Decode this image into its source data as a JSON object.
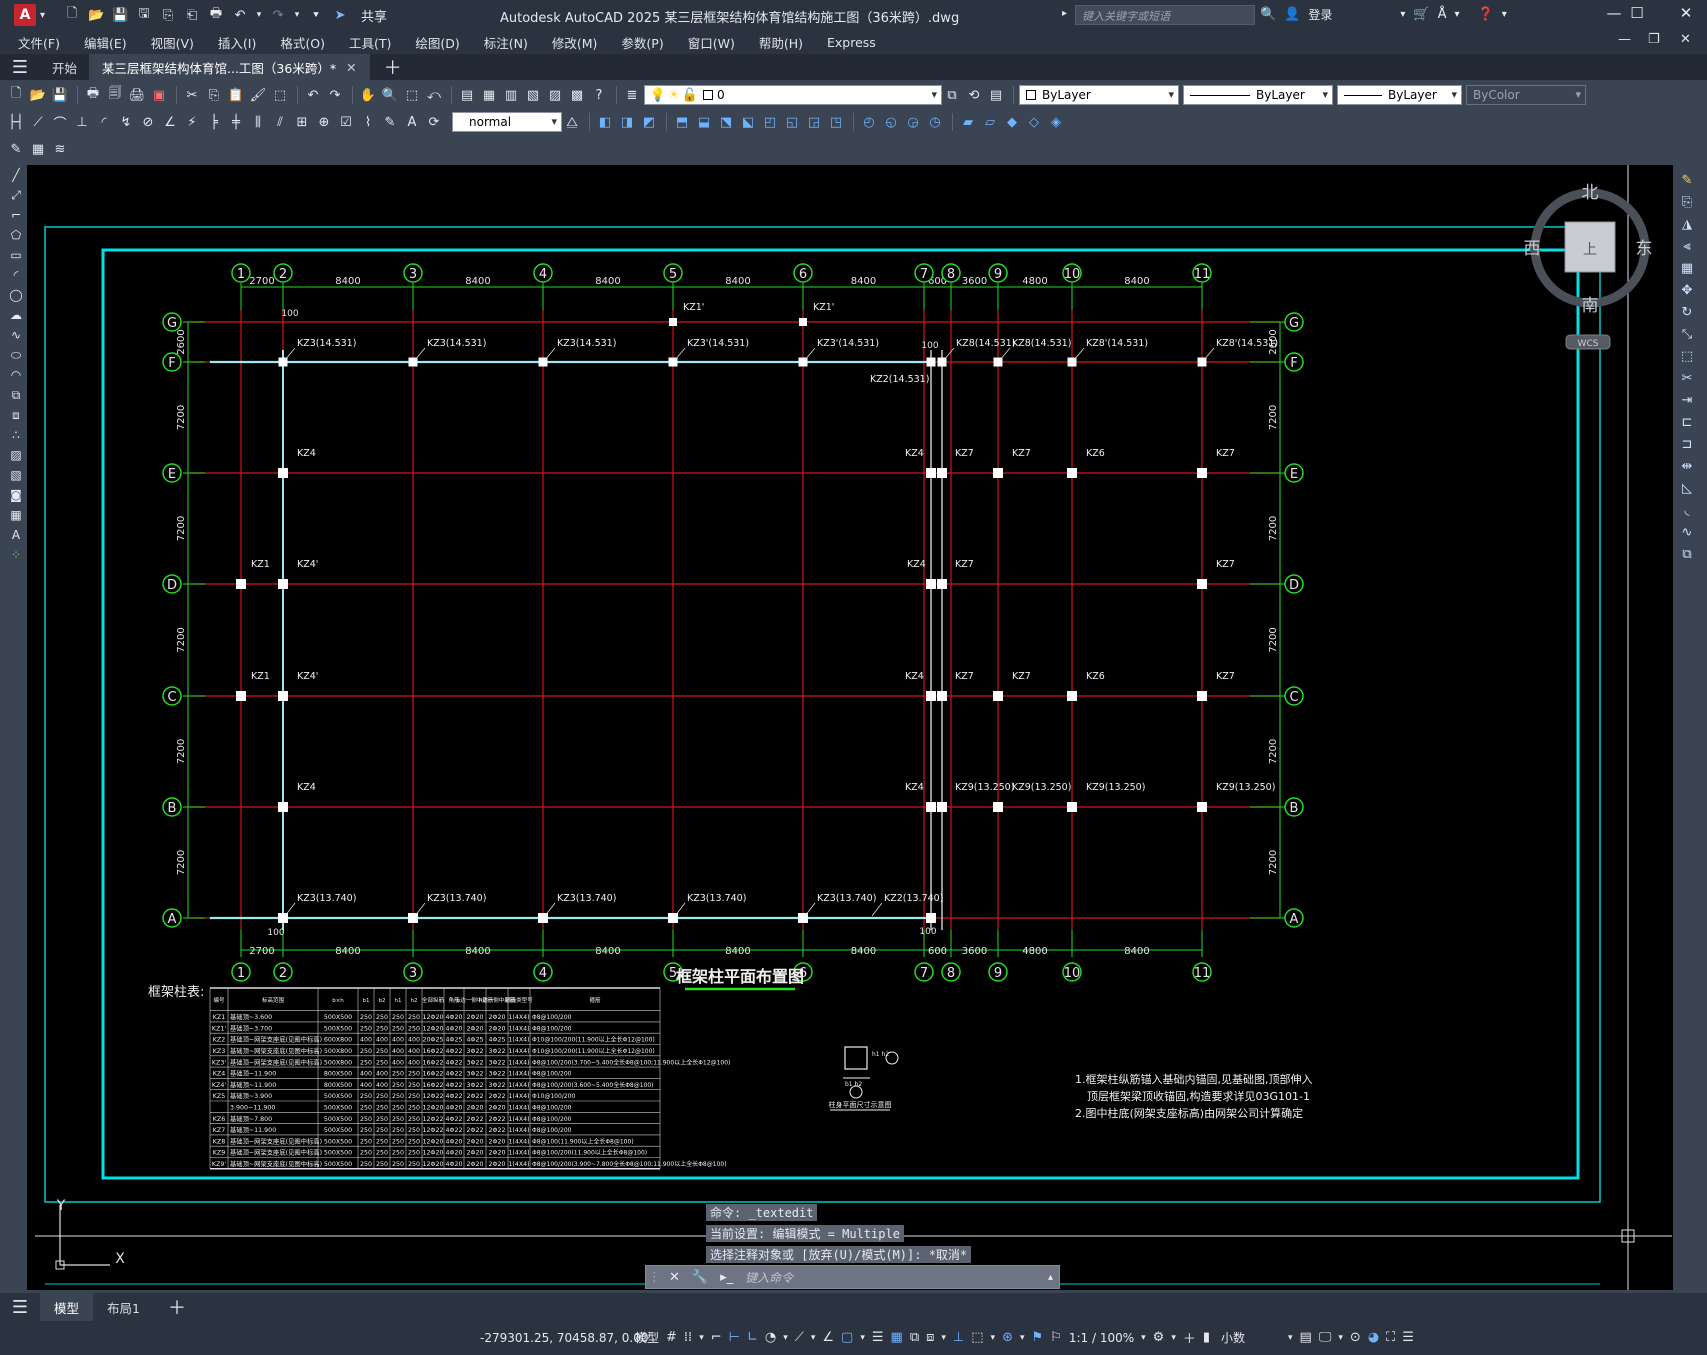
{
  "app": {
    "title": "Autodesk AutoCAD 2025    某三层框架结构体育馆结构施工图（36米跨）.dwg",
    "logo_letter": "A",
    "share_label": "共享",
    "search_placeholder": "键入关键字或短语",
    "login_label": "登录"
  },
  "menu": [
    "文件(F)",
    "编辑(E)",
    "视图(V)",
    "插入(I)",
    "格式(O)",
    "工具(T)",
    "绘图(D)",
    "标注(N)",
    "修改(M)",
    "参数(P)",
    "窗口(W)",
    "帮助(H)",
    "Express"
  ],
  "tabs": {
    "start": "开始",
    "doc": "某三层框架结构体育馆...工图（36米跨）*"
  },
  "toolbar": {
    "layer_name": "0",
    "color": "ByLayer",
    "linetype": "ByLayer",
    "lineweight": "ByLayer",
    "plotstyle": "ByColor",
    "textstyle": "normal"
  },
  "viewcube": {
    "north": "北",
    "south": "南",
    "east": "东",
    "west": "西",
    "top": "上",
    "ucs": "WCS"
  },
  "drawing": {
    "title": "框架柱平面布置图",
    "table_title": "框架柱表:",
    "axes_cols": [
      "1",
      "2",
      "3",
      "4",
      "5",
      "6",
      "7",
      "8",
      "9",
      "10",
      "11"
    ],
    "axes_rows": [
      "G",
      "F",
      "E",
      "D",
      "C",
      "B",
      "A"
    ],
    "dims_top": [
      "2700",
      "8400",
      "8400",
      "8400",
      "8400",
      "8400",
      "600",
      "3600",
      "4800",
      "8400"
    ],
    "dims_left": [
      "2600",
      "7200",
      "7200",
      "7200",
      "7200",
      "7200"
    ],
    "dim_100": "100",
    "labels": {
      "F_row": [
        "KZ3(14.531)",
        "KZ3(14.531)",
        "KZ3(14.531)",
        "KZ3'(14.531)",
        "KZ3'(14.531)",
        "KZ8(14.531)",
        "KZ8(14.531)",
        "KZ8'(14.531)",
        "KZ8'(14.531)"
      ],
      "G_row": [
        "KZ1'",
        "KZ1'"
      ],
      "kz2_note": "KZ2(14.531)",
      "A_row": [
        "KZ3(13.740)",
        "KZ3(13.740)",
        "KZ3(13.740)",
        "KZ3(13.740)",
        "KZ3(13.740)",
        "KZ2(13.740)"
      ],
      "B_row": [
        "KZ4",
        "KZ4",
        "KZ9(13.250)",
        "KZ9(13.250)",
        "KZ9(13.250)",
        "KZ9(13.250)"
      ],
      "E_row": [
        "KZ4",
        "KZ4",
        "KZ7",
        "KZ7",
        "KZ6",
        "KZ7"
      ],
      "D_row": [
        "KZ1",
        "KZ4'",
        "KZ4",
        "KZ7",
        "KZ7"
      ],
      "C_row": [
        "KZ1",
        "KZ4'",
        "KZ4",
        "KZ7",
        "KZ7",
        "KZ6",
        "KZ7"
      ]
    },
    "table": {
      "header": [
        "编号",
        "标高范围",
        "b×h",
        "b1",
        "b2",
        "h1",
        "h2",
        "全部纵筋",
        "角筋",
        "b边一侧中部筋",
        "h边一侧中部筋",
        "箍筋类型号",
        "箍筋"
      ],
      "rows": [
        [
          "KZ1",
          "基础顶~3.600",
          "500X500",
          "250",
          "250",
          "250",
          "250",
          "12Φ20",
          "4Φ20",
          "2Φ20",
          "2Φ20",
          "1(4X4)",
          "Φ8@100/200"
        ],
        [
          "KZ1'",
          "基础顶~3.700",
          "500X500",
          "250",
          "250",
          "250",
          "250",
          "12Φ20",
          "4Φ20",
          "2Φ20",
          "2Φ20",
          "1(4X4)",
          "Φ8@100/200"
        ],
        [
          "KZ2",
          "基础顶~网架支座底(见图中标高)",
          "600X800",
          "400",
          "400",
          "400",
          "400",
          "20Φ25",
          "4Φ25",
          "4Φ25",
          "4Φ25",
          "1(4X4)",
          "Φ10@100/200(11.900以上全长Φ12@100)"
        ],
        [
          "KZ3",
          "基础顶~网架支座底(见图中标高)",
          "500X800",
          "250",
          "250",
          "400",
          "400",
          "16Φ22",
          "4Φ22",
          "3Φ22",
          "3Φ22",
          "1(4X4)",
          "Φ10@100/200(11.900以上全长Φ12@100)"
        ],
        [
          "KZ3'",
          "基础顶~网架支座底(见图中标高)",
          "500X800",
          "250",
          "250",
          "400",
          "400",
          "16Φ22",
          "4Φ22",
          "3Φ22",
          "3Φ22",
          "1(4X4)",
          "Φ8@100/200(3.700~5.400全长Φ8@100;11.900以上全长Φ12@100)"
        ],
        [
          "KZ4",
          "基础顶~11.900",
          "800X500",
          "400",
          "400",
          "250",
          "250",
          "16Φ22",
          "4Φ22",
          "3Φ22",
          "3Φ22",
          "1(4X4)",
          "Φ8@100/200"
        ],
        [
          "KZ4'",
          "基础顶~11.900",
          "800X500",
          "400",
          "400",
          "250",
          "250",
          "16Φ22",
          "4Φ22",
          "3Φ22",
          "3Φ22",
          "1(4X4)",
          "Φ8@100/200(3.600~5.400全长Φ8@100)"
        ],
        [
          "KZ5",
          "基础顶~3.900",
          "500X500",
          "250",
          "250",
          "250",
          "250",
          "12Φ22",
          "4Φ22",
          "2Φ22",
          "2Φ22",
          "1(4X4)",
          "Φ10@100/200"
        ],
        [
          "",
          "3.900~11.900",
          "500X500",
          "250",
          "250",
          "250",
          "250",
          "12Φ20",
          "4Φ20",
          "2Φ20",
          "2Φ20",
          "1(4X4)",
          "Φ8@100/200"
        ],
        [
          "KZ6",
          "基础顶~7.800",
          "500X500",
          "250",
          "250",
          "250",
          "250",
          "12Φ22",
          "4Φ22",
          "2Φ22",
          "2Φ22",
          "1(4X4)",
          "Φ8@100/200"
        ],
        [
          "KZ7",
          "基础顶~11.900",
          "500X500",
          "250",
          "250",
          "250",
          "250",
          "12Φ22",
          "4Φ22",
          "2Φ22",
          "2Φ22",
          "1(4X4)",
          "Φ8@100/200"
        ],
        [
          "KZ8",
          "基础顶~网架支座底(见图中标高)",
          "500X500",
          "250",
          "250",
          "250",
          "250",
          "12Φ20",
          "4Φ20",
          "2Φ20",
          "2Φ20",
          "1(4X4)",
          "Φ8@100(11.900以上全长Φ8@100)"
        ],
        [
          "KZ9",
          "基础顶~网架支座底(见图中标高)",
          "500X500",
          "250",
          "250",
          "250",
          "250",
          "12Φ20",
          "4Φ20",
          "2Φ20",
          "2Φ20",
          "1(4X4)",
          "Φ8@100/200(11.900以上全长Φ8@100)"
        ],
        [
          "KZ9'",
          "基础顶~网架支座底(见图中标高)",
          "500X500",
          "250",
          "250",
          "250",
          "250",
          "12Φ20",
          "4Φ20",
          "2Φ20",
          "2Φ20",
          "1(4X4)",
          "Φ8@100/200(3.900~7.800全长Φ8@100;11.900以上全长Φ8@100)"
        ]
      ]
    },
    "detail_caption": "柱身平面尺寸示意图",
    "detail_labels": [
      "b1",
      "b2",
      "h1",
      "h2"
    ],
    "notes": [
      "1.框架柱纵筋锚入基础内锚固,见基础图,顶部伸入",
      "顶层框架梁顶收锚固,构造要求详见03G101-1",
      "2.图中柱底(网架支座标高)由网架公司计算确定"
    ]
  },
  "command": {
    "lines": [
      "命令: _textedit",
      "当前设置: 编辑模式 = Multiple",
      "选择注释对象或 [放弃(U)/模式(M)]: *取消*"
    ],
    "placeholder": "键入命令"
  },
  "layouts": {
    "model": "模型",
    "layout1": "布局1"
  },
  "status": {
    "coords": "-279301.25, 70458.87, 0.00",
    "mode": "模型",
    "scale": "1:1 / 100%",
    "units": "小数"
  }
}
